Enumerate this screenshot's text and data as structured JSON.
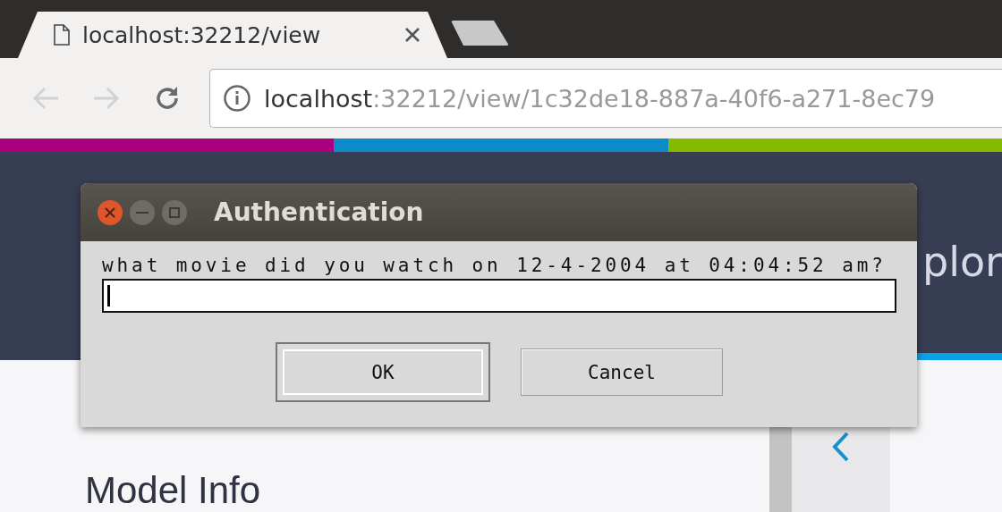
{
  "browser": {
    "tabs": [
      {
        "title": "localhost:32212/view",
        "selected": true
      }
    ],
    "nav": [
      {
        "kind": "back",
        "disabled": true
      },
      {
        "kind": "forward",
        "disabled": true
      },
      {
        "kind": "reload",
        "disabled": false
      }
    ],
    "address": {
      "host": "localhost",
      "path": ":32212/view/1c32de18-887a-40f6-a271-8ec79"
    }
  },
  "stripe": [
    {
      "color": "#a8007e"
    },
    {
      "color": "#0b8bc8"
    },
    {
      "color": "#84bb00"
    }
  ],
  "page": {
    "header_text": "plor",
    "heading": "Model Info"
  },
  "dialog": {
    "title": "Authentication",
    "prompt": "what movie did you watch on 12-4-2004 at 04:04:52 am?",
    "buttons": [
      {
        "label": "OK",
        "default": true
      },
      {
        "label": "Cancel",
        "default": false
      }
    ]
  }
}
